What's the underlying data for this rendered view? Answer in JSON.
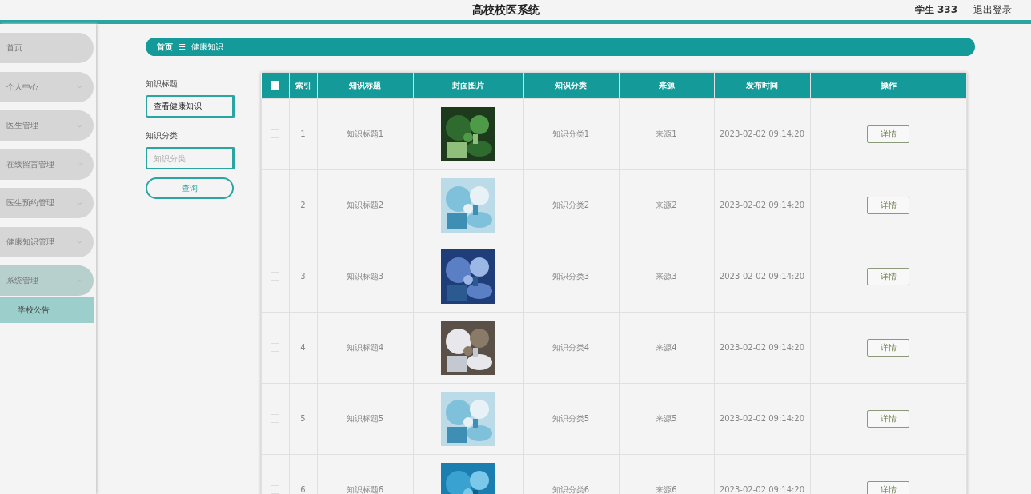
{
  "header": {
    "title": "高校校医系统",
    "user": "学生 333",
    "logout": "退出登录"
  },
  "sidebar": {
    "items": [
      {
        "label": "首页",
        "has_menu": false,
        "expanded": false
      },
      {
        "label": "个人中心",
        "has_menu": true,
        "expanded": false
      },
      {
        "label": "医生管理",
        "has_menu": true,
        "expanded": false
      },
      {
        "label": "在线留言管理",
        "has_menu": true,
        "expanded": false
      },
      {
        "label": "医生预约管理",
        "has_menu": true,
        "expanded": false
      },
      {
        "label": "健康知识管理",
        "has_menu": true,
        "expanded": false
      },
      {
        "label": "系统管理",
        "has_menu": true,
        "expanded": true,
        "children": [
          {
            "label": "学校公告",
            "selected": true
          }
        ]
      }
    ]
  },
  "breadcrumb": {
    "home": "首页",
    "separator": "☰",
    "current": "健康知识"
  },
  "filters": [
    {
      "label": "知识标题",
      "value": "查看健康知识"
    },
    {
      "label": "知识分类",
      "placeholder": "知识分类"
    }
  ],
  "search_button": "查询",
  "table": {
    "columns": [
      "索引",
      "知识标题",
      "封面图片",
      "知识分类",
      "来源",
      "发布时间",
      "操作"
    ],
    "header_checked": false,
    "rows": [
      {
        "checked": false,
        "index": "1",
        "title": "知识标题1",
        "category": "知识分类1",
        "source": "来源1",
        "time": "2023-02-02 09:14:20",
        "action": "详情"
      },
      {
        "checked": false,
        "index": "2",
        "title": "知识标题2",
        "category": "知识分类2",
        "source": "来源2",
        "time": "2023-02-02 09:14:20",
        "action": "详情"
      },
      {
        "checked": false,
        "index": "3",
        "title": "知识标题3",
        "category": "知识分类3",
        "source": "来源3",
        "time": "2023-02-02 09:14:20",
        "action": "详情"
      },
      {
        "checked": false,
        "index": "4",
        "title": "知识标题4",
        "category": "知识分类4",
        "source": "来源4",
        "time": "2023-02-02 09:14:20",
        "action": "详情"
      },
      {
        "checked": false,
        "index": "5",
        "title": "知识标题5",
        "category": "知识分类5",
        "source": "来源5",
        "time": "2023-02-02 09:14:20",
        "action": "详情"
      },
      {
        "checked": false,
        "index": "6",
        "title": "知识标题6",
        "category": "知识分类6",
        "source": "来源6",
        "time": "2023-02-02 09:14:20",
        "action": "详情"
      }
    ]
  }
}
